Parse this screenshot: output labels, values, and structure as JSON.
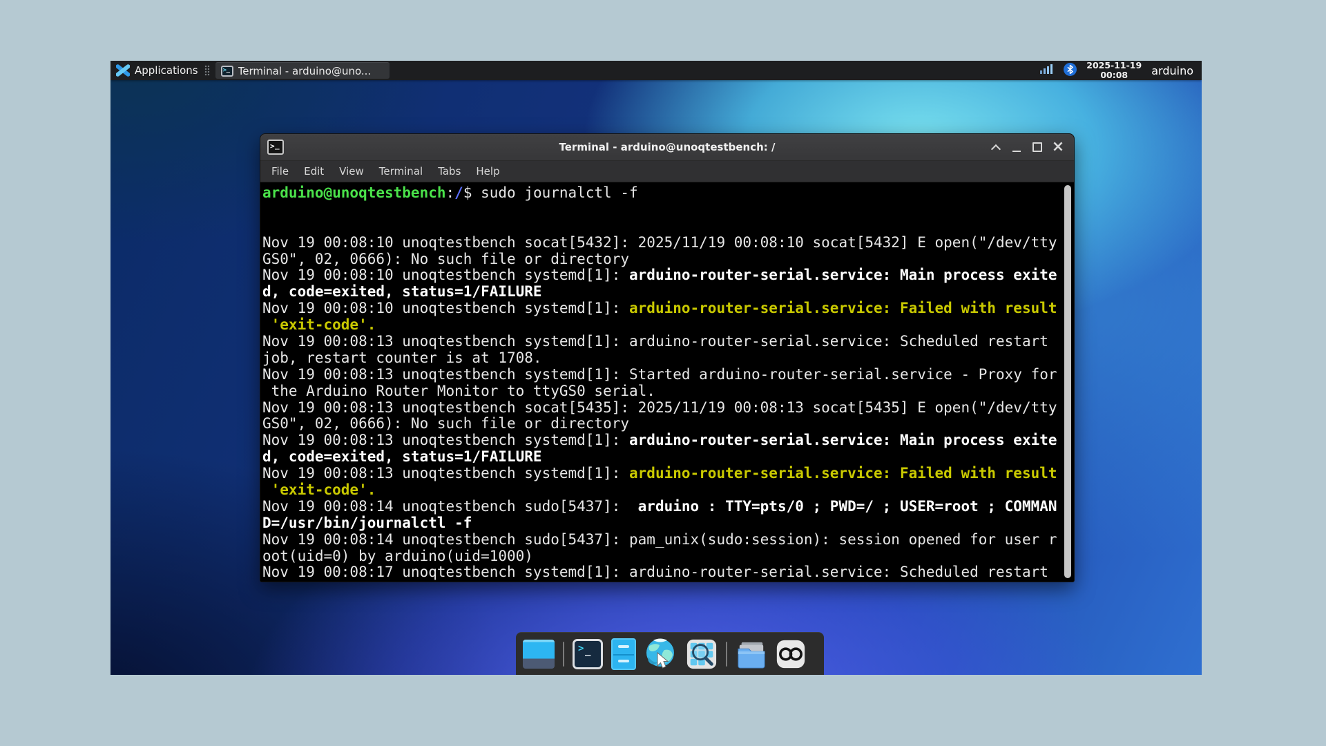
{
  "panel": {
    "applications_label": "Applications",
    "taskbar_button": "Terminal - arduino@uno...",
    "tray": {
      "date": "2025-11-19",
      "time": "00:08",
      "user": "arduino",
      "icons": [
        "network-signal-icon",
        "bluetooth-icon"
      ]
    }
  },
  "window": {
    "title": "Terminal - arduino@unoqtestbench: /",
    "menu_items": [
      "File",
      "Edit",
      "View",
      "Terminal",
      "Tabs",
      "Help"
    ],
    "controls": [
      "shade",
      "minimize",
      "maximize",
      "close"
    ]
  },
  "terminal": {
    "columns": 91,
    "rows": [
      [
        {
          "t": "arduino@unoqtestbench",
          "c": "g"
        },
        {
          "t": ":",
          "c": "w"
        },
        {
          "t": "/",
          "c": "bl"
        },
        {
          "t": "$ sudo journalctl -f",
          "c": "w"
        }
      ],
      [],
      [],
      [
        {
          "t": "Nov 19 00:08:10 unoqtestbench socat[5432]: 2025/11/19 00:08:10 socat[5432] E open(\"/dev/tty",
          "c": "w"
        }
      ],
      [
        {
          "t": "GS0\", 02, 0666): No such file or directory",
          "c": "w"
        }
      ],
      [
        {
          "t": "Nov 19 00:08:10 unoqtestbench systemd[1]: ",
          "c": "w"
        },
        {
          "t": "arduino-router-serial.service: Main process exite",
          "c": "b"
        }
      ],
      [
        {
          "t": "d, code=exited, status=1/FAILURE",
          "c": "b"
        }
      ],
      [
        {
          "t": "Nov 19 00:08:10 unoqtestbench systemd[1]: ",
          "c": "w"
        },
        {
          "t": "arduino-router-serial.service: Failed with result",
          "c": "y"
        }
      ],
      [
        {
          "t": " 'exit-code'.",
          "c": "y"
        }
      ],
      [
        {
          "t": "Nov 19 00:08:13 unoqtestbench systemd[1]: arduino-router-serial.service: Scheduled restart",
          "c": "w"
        }
      ],
      [
        {
          "t": "job, restart counter is at 1708.",
          "c": "w"
        }
      ],
      [
        {
          "t": "Nov 19 00:08:13 unoqtestbench systemd[1]: Started arduino-router-serial.service - Proxy for",
          "c": "w"
        }
      ],
      [
        {
          "t": " the Arduino Router Monitor to ttyGS0 serial.",
          "c": "w"
        }
      ],
      [
        {
          "t": "Nov 19 00:08:13 unoqtestbench socat[5435]: 2025/11/19 00:08:13 socat[5435] E open(\"/dev/tty",
          "c": "w"
        }
      ],
      [
        {
          "t": "GS0\", 02, 0666): No such file or directory",
          "c": "w"
        }
      ],
      [
        {
          "t": "Nov 19 00:08:13 unoqtestbench systemd[1]: ",
          "c": "w"
        },
        {
          "t": "arduino-router-serial.service: Main process exite",
          "c": "b"
        }
      ],
      [
        {
          "t": "d, code=exited, status=1/FAILURE",
          "c": "b"
        }
      ],
      [
        {
          "t": "Nov 19 00:08:13 unoqtestbench systemd[1]: ",
          "c": "w"
        },
        {
          "t": "arduino-router-serial.service: Failed with result",
          "c": "y"
        }
      ],
      [
        {
          "t": " 'exit-code'.",
          "c": "y"
        }
      ],
      [
        {
          "t": "Nov 19 00:08:14 unoqtestbench sudo[5437]:  ",
          "c": "w"
        },
        {
          "t": "arduino : TTY=pts/0 ; PWD=/ ; USER=root ; COMMAN",
          "c": "b"
        }
      ],
      [
        {
          "t": "D=/usr/bin/journalctl -f",
          "c": "b"
        }
      ],
      [
        {
          "t": "Nov 19 00:08:14 unoqtestbench sudo[5437]: pam_unix(sudo:session): session opened for user r",
          "c": "w"
        }
      ],
      [
        {
          "t": "oot(uid=0) by arduino(uid=1000)",
          "c": "w"
        }
      ],
      [
        {
          "t": "Nov 19 00:08:17 unoqtestbench systemd[1]: arduino-router-serial.service: Scheduled restart",
          "c": "w"
        }
      ]
    ]
  },
  "dock": {
    "items": [
      {
        "icon": "show-desktop-icon"
      },
      {
        "icon": "separator"
      },
      {
        "icon": "terminal-icon"
      },
      {
        "icon": "file-manager-icon"
      },
      {
        "icon": "web-browser-icon"
      },
      {
        "icon": "app-finder-icon"
      },
      {
        "icon": "separator"
      },
      {
        "icon": "file-folder-icon"
      },
      {
        "icon": "arduino-ide-icon"
      }
    ]
  },
  "colors": {
    "panel_bg": "#1d1e20",
    "frame_bg": "#b5c9d2",
    "terminal_fg": "#e6e6e6",
    "terminal_bold": "#ffffff",
    "terminal_yellow": "#c9c900",
    "terminal_green": "#4ae24a",
    "terminal_blue": "#5c6eff"
  }
}
